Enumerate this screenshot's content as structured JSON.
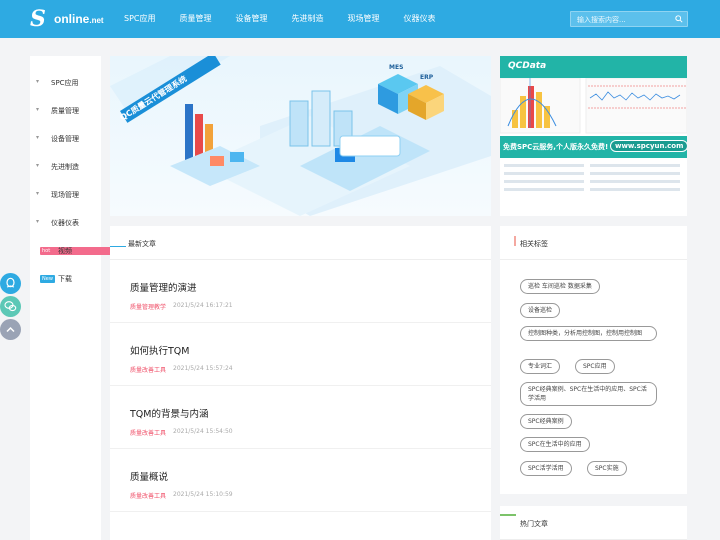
{
  "header": {
    "logo_text": "online",
    "logo_suffix": ".net",
    "nav": [
      "SPC应用",
      "质量管理",
      "设备管理",
      "先进制造",
      "现场管理",
      "仪器仪表"
    ],
    "search_placeholder": "输入搜索内容..."
  },
  "sidebar": {
    "items": [
      "SPC应用",
      "质量管理",
      "设备管理",
      "先进制造",
      "现场管理",
      "仪器仪表"
    ],
    "tagged": [
      {
        "tag": "hot",
        "label": "视频"
      },
      {
        "tag": "New",
        "label": "下载"
      }
    ]
  },
  "banner": {
    "slogan": "QC质量云代管理系统",
    "labels": [
      "MES",
      "ERP"
    ]
  },
  "ad": {
    "brand": "QCData",
    "promo": "免费SPC云服务,个人版永久免费!",
    "url": "www.spcyun.com"
  },
  "articles": {
    "title": "最新文章",
    "items": [
      {
        "title": "质量管理的演进",
        "category": "质量管理教学",
        "time": "2021/5/24 16:17:21"
      },
      {
        "title": "如何执行TQM",
        "category": "质量改善工具",
        "time": "2021/5/24 15:57:24"
      },
      {
        "title": "TQM的背景与内涵",
        "category": "质量改善工具",
        "time": "2021/5/24 15:54:50"
      },
      {
        "title": "质量概说",
        "category": "质量改善工具",
        "time": "2021/5/24 15:10:59"
      }
    ]
  },
  "tags": {
    "title": "相关标签",
    "items": [
      "巡检 车间巡检 数据采集",
      "设备巡检",
      "控制图种类，分析用控制图，控制用控制图",
      "专业词汇",
      "SPC应用",
      "SPC经典案例、SPC在生活中的应用、SPC活学活用",
      "SPC经典案例",
      "SPC在生活中的应用",
      "SPC活学活用",
      "SPC实施"
    ]
  },
  "hot": {
    "title": "热门文章"
  }
}
